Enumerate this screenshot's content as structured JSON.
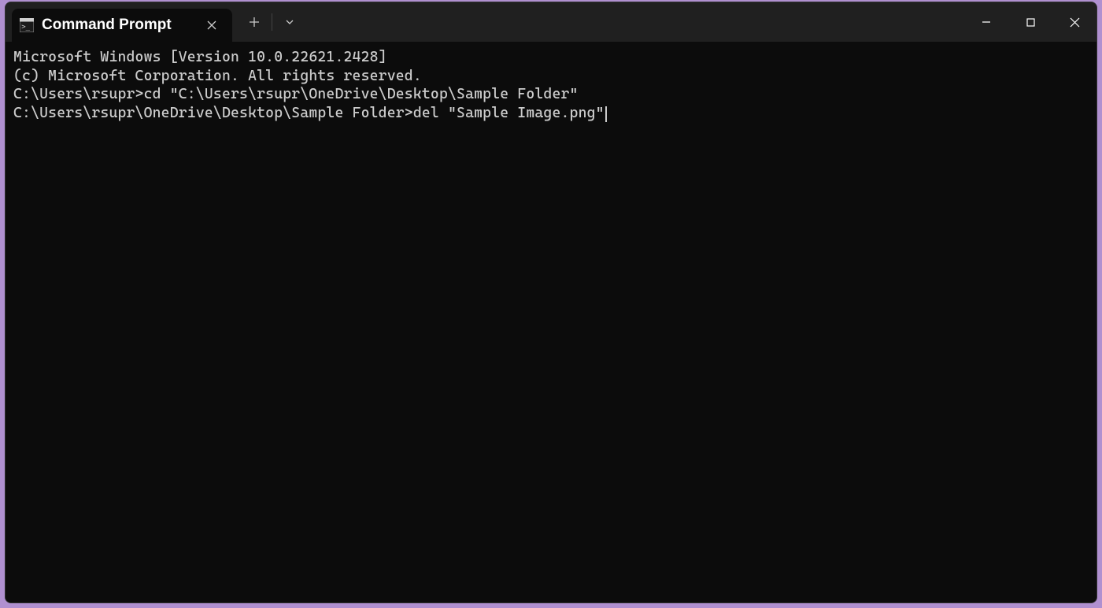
{
  "window": {
    "tab_title": "Command Prompt"
  },
  "terminal": {
    "lines": [
      "Microsoft Windows [Version 10.0.22621.2428]",
      "(c) Microsoft Corporation. All rights reserved.",
      "",
      "C:\\Users\\rsupr>cd \"C:\\Users\\rsupr\\OneDrive\\Desktop\\Sample Folder\"",
      "",
      "C:\\Users\\rsupr\\OneDrive\\Desktop\\Sample Folder>del \"Sample Image.png\""
    ],
    "cursor_on_last_line": true
  }
}
